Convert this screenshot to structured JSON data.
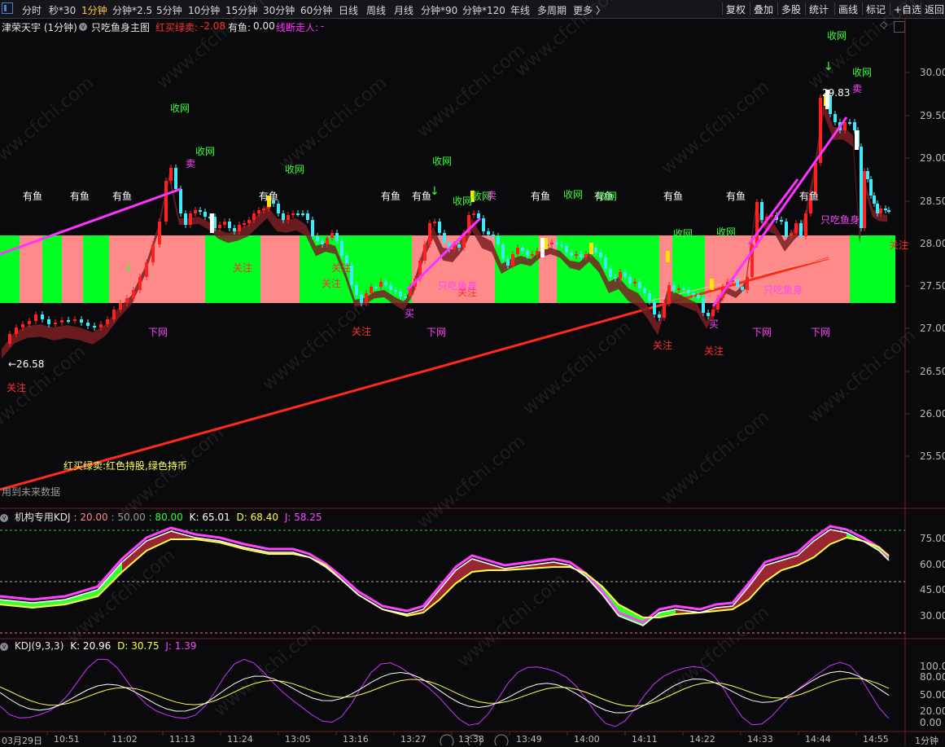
{
  "toolbar": {
    "periods": [
      "分时",
      "秒*30",
      "1分钟",
      "分钟*2.5",
      "5分钟",
      "10分钟",
      "15分钟",
      "30分钟",
      "60分钟",
      "日线",
      "周线",
      "月线",
      "分钟*90",
      "分钟*120",
      "年线",
      "多周期",
      "更多 〉"
    ],
    "active_period": "1分钟",
    "right_buttons": [
      "复权",
      "叠加",
      "多股",
      "统计",
      "画线",
      "标记",
      "+自选",
      "返回"
    ]
  },
  "main_header": {
    "stock": "津荣天宇 (1分钟)",
    "indicator": "只吃鱼身主图",
    "hongmai_label": "红买绿卖:",
    "hongmai_value": "-2.08",
    "youyu_label": "有鱼:",
    "youyu_value": "0.00",
    "xianduan_label": "线断走人:",
    "xianduan_value": "-"
  },
  "price_axis": [
    "30.00",
    "29.50",
    "29.00",
    "28.50",
    "28.00",
    "27.50",
    "27.00",
    "26.50",
    "26.00",
    "25.50"
  ],
  "annotations": {
    "low_price": "26.58",
    "high_price": "29.83",
    "legend_note": "红买绿卖:红色持股,绿色持币",
    "future_note": "用到未来数据",
    "yu": "有鱼",
    "shouwang": "收网",
    "guanzhu": "关注",
    "xiawang": "下网",
    "mai_buy": "买",
    "mai_sell": "卖",
    "yushen": "只吃鱼身"
  },
  "kdj1_header": {
    "name": "机构专用KDJ",
    "v1": ": 20.00",
    "v2": ": 50.00",
    "v3": ": 80.00",
    "k": "K: 65.01",
    "d": "D: 68.40",
    "j": "J: 58.25"
  },
  "kdj1_axis": [
    "75.00",
    "60.00",
    "45.00",
    "30.00"
  ],
  "kdj2_header": {
    "name": "KDJ(9,3,3)",
    "k": "K: 20.96",
    "d": "D: 30.75",
    "j": "J: 1.39"
  },
  "kdj2_axis": [
    "100.00",
    "80.00",
    "50.00",
    "20.00",
    "0.00"
  ],
  "time_axis": {
    "date": "03月29日",
    "times": [
      "10:51",
      "11:02",
      "11:13",
      "11:24",
      "13:05",
      "13:16",
      "13:27",
      "13:38",
      "13:49",
      "14:00",
      "14:11",
      "14:22",
      "14:33",
      "14:44",
      "14:55"
    ],
    "period_label": "1分钟"
  },
  "watermark": "www.cfchi.com",
  "colors": {
    "up": "#ff2020",
    "down": "#40e8f8",
    "band_red": "#ff8a8a",
    "band_green": "#00ff22",
    "magenta": "#ff33ff",
    "trend": "#ff1a1a",
    "yellow_text": "#ffff55"
  },
  "chart_data": {
    "type": "candlestick",
    "title": "津荣天宇 (1分钟)",
    "x": [
      "10:51",
      "11:02",
      "11:13",
      "11:24",
      "13:05",
      "13:16",
      "13:27",
      "13:38",
      "13:49",
      "14:00",
      "14:11",
      "14:22",
      "14:33",
      "14:44",
      "14:55"
    ],
    "close_approx": [
      26.9,
      27.2,
      28.5,
      28.3,
      28.4,
      27.6,
      27.5,
      28.4,
      28.0,
      28.0,
      27.5,
      27.3,
      28.5,
      29.5,
      28.5
    ],
    "ylim": [
      25.2,
      30.3
    ],
    "low_marker": 26.58,
    "high_marker": 29.83,
    "band_range": [
      27.3,
      28.1
    ],
    "kdj_institutional": {
      "k": 65.01,
      "d": 68.4,
      "j": 58.25,
      "levels": [
        20,
        50,
        80
      ]
    },
    "kdj_933": {
      "k": 20.96,
      "d": 30.75,
      "j": 1.39
    }
  }
}
